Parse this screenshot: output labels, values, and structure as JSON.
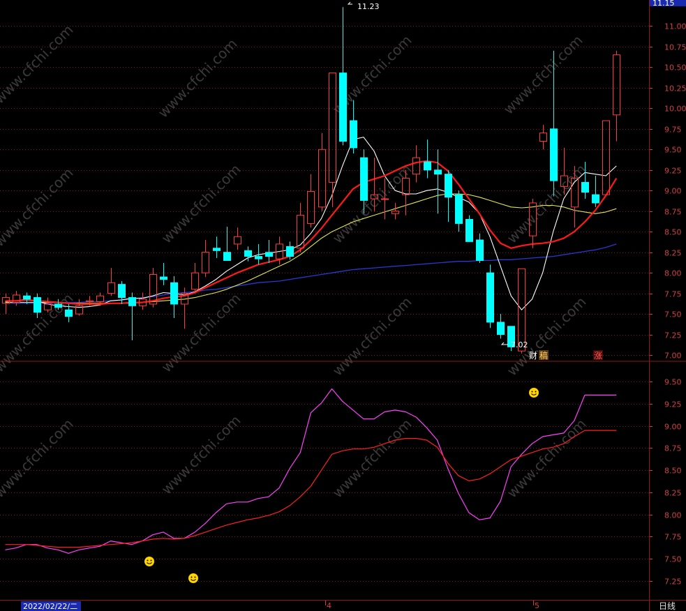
{
  "colors": {
    "background": "#000000",
    "frame": "#8b1a1a",
    "grid": "#7a1a1a",
    "tick_text": "#d04040",
    "up_candle": "#ff3c3c",
    "down_candle": "#00ffff",
    "ma_fast": "#ffffff",
    "ma_mid": "#ff1a1a",
    "ma_slow": "#e8e84a",
    "ma_long": "#2838d0",
    "osc_fast": "#ff40ff",
    "osc_slow": "#ff2020"
  },
  "header": {
    "price_box": "11.15"
  },
  "footer": {
    "date_box": "2022/02/22/二",
    "period_label": "日线",
    "month_4": "4",
    "month_5": "5"
  },
  "watermark": "www.cfchi.com",
  "markers": {
    "high_label": "11.23",
    "low_label": "7.02",
    "tag_cai": "财",
    "tag_gao": "稿",
    "tag_zhang": "涨"
  },
  "chart_data": [
    {
      "type": "candlestick",
      "title": "",
      "ylim": [
        6.95,
        11.3
      ],
      "y_ticks": [
        "11.00",
        "10.75",
        "10.50",
        "10.25",
        "10.00",
        "9.75",
        "9.50",
        "9.25",
        "9.00",
        "8.75",
        "8.50",
        "8.25",
        "8.00",
        "7.75",
        "7.50",
        "7.25",
        "7.00"
      ],
      "candles": [
        [
          7.63,
          7.7,
          7.75,
          7.5
        ],
        [
          7.64,
          7.73,
          7.78,
          7.6
        ],
        [
          7.72,
          7.68,
          7.76,
          7.62
        ],
        [
          7.7,
          7.52,
          7.75,
          7.45
        ],
        [
          7.55,
          7.62,
          7.7,
          7.52
        ],
        [
          7.62,
          7.58,
          7.68,
          7.55
        ],
        [
          7.55,
          7.47,
          7.62,
          7.4
        ],
        [
          7.5,
          7.6,
          7.68,
          7.48
        ],
        [
          7.65,
          7.66,
          7.72,
          7.6
        ],
        [
          7.65,
          7.72,
          7.76,
          7.6
        ],
        [
          7.75,
          7.88,
          8.06,
          7.72
        ],
        [
          7.86,
          7.7,
          7.9,
          7.62
        ],
        [
          7.7,
          7.6,
          7.76,
          7.18
        ],
        [
          7.6,
          7.68,
          7.76,
          7.55
        ],
        [
          7.62,
          7.98,
          8.06,
          7.58
        ],
        [
          7.95,
          7.92,
          8.12,
          7.85
        ],
        [
          7.88,
          7.62,
          7.96,
          7.45
        ],
        [
          7.62,
          7.75,
          7.82,
          7.32
        ],
        [
          7.8,
          8.0,
          8.12,
          7.75
        ],
        [
          8.0,
          8.25,
          8.4,
          7.95
        ],
        [
          8.3,
          8.27,
          8.44,
          8.18
        ],
        [
          8.25,
          8.15,
          8.56,
          8.2
        ],
        [
          8.35,
          8.44,
          8.55,
          8.28
        ],
        [
          8.27,
          8.2,
          8.32,
          8.14
        ],
        [
          8.2,
          8.17,
          8.35,
          8.1
        ],
        [
          8.25,
          8.2,
          8.4,
          8.12
        ],
        [
          8.17,
          8.35,
          8.44,
          8.1
        ],
        [
          8.32,
          8.2,
          8.38,
          8.16
        ],
        [
          8.3,
          8.7,
          8.85,
          8.25
        ],
        [
          8.6,
          8.99,
          9.2,
          8.55
        ],
        [
          8.8,
          9.5,
          9.7,
          8.75
        ],
        [
          9.1,
          10.43,
          10.43,
          8.8
        ],
        [
          10.43,
          9.6,
          11.23,
          9.55
        ],
        [
          9.85,
          9.52,
          10.1,
          9.45
        ],
        [
          9.4,
          8.88,
          9.5,
          8.72
        ],
        [
          8.9,
          8.95,
          9.4,
          8.75
        ],
        [
          8.9,
          8.9,
          9.15,
          8.65
        ],
        [
          8.72,
          8.75,
          8.85,
          8.65
        ],
        [
          8.95,
          9.15,
          9.25,
          8.7
        ],
        [
          9.2,
          9.4,
          9.55,
          9.1
        ],
        [
          9.35,
          9.25,
          9.62,
          9.15
        ],
        [
          9.25,
          9.2,
          9.5,
          8.72
        ],
        [
          9.2,
          8.92,
          9.25,
          8.62
        ],
        [
          8.95,
          8.6,
          9.0,
          8.5
        ],
        [
          8.65,
          8.38,
          8.7,
          8.38
        ],
        [
          8.4,
          8.15,
          8.48,
          8.12
        ],
        [
          8.0,
          7.4,
          8.1,
          7.33
        ],
        [
          7.4,
          7.25,
          7.5,
          7.2
        ],
        [
          7.35,
          7.1,
          7.25,
          7.05
        ],
        [
          7.05,
          8.05,
          8.05,
          7.02
        ],
        [
          8.45,
          8.85,
          8.9,
          8.3
        ],
        [
          9.6,
          9.7,
          9.8,
          9.5
        ],
        [
          9.75,
          9.12,
          10.7,
          8.93
        ],
        [
          9.05,
          9.18,
          9.52,
          8.95
        ],
        [
          8.8,
          9.15,
          9.3,
          8.55
        ],
        [
          9.1,
          8.98,
          9.35,
          8.9
        ],
        [
          8.95,
          8.85,
          9.18,
          8.8
        ],
        [
          8.95,
          9.85,
          9.85,
          8.95
        ],
        [
          9.92,
          10.65,
          10.7,
          9.6
        ]
      ],
      "ma_fast": [
        7.65,
        7.66,
        7.68,
        7.66,
        7.62,
        7.6,
        7.59,
        7.58,
        7.59,
        7.61,
        7.66,
        7.67,
        7.69,
        7.69,
        7.72,
        7.76,
        7.75,
        7.73,
        7.77,
        7.84,
        7.92,
        8.02,
        8.1,
        8.18,
        8.22,
        8.24,
        8.26,
        8.28,
        8.34,
        8.48,
        8.66,
        8.94,
        9.3,
        9.62,
        9.65,
        9.48,
        9.18,
        9.0,
        8.96,
        8.96,
        9.0,
        9.02,
        8.98,
        8.92,
        8.86,
        8.72,
        8.44,
        8.08,
        7.72,
        7.55,
        7.68,
        8.0,
        8.5,
        8.9,
        9.1,
        9.22,
        9.2,
        9.18,
        9.3
      ],
      "ma_mid": [
        7.66,
        7.66,
        7.67,
        7.66,
        7.65,
        7.64,
        7.63,
        7.62,
        7.62,
        7.62,
        7.63,
        7.63,
        7.64,
        7.64,
        7.66,
        7.69,
        7.71,
        7.72,
        7.76,
        7.82,
        7.88,
        7.94,
        8.0,
        8.05,
        8.1,
        8.13,
        8.16,
        8.2,
        8.28,
        8.4,
        8.54,
        8.7,
        8.86,
        9.02,
        9.1,
        9.14,
        9.18,
        9.24,
        9.3,
        9.34,
        9.36,
        9.34,
        9.24,
        9.08,
        8.9,
        8.72,
        8.52,
        8.36,
        8.3,
        8.33,
        8.35,
        8.36,
        8.38,
        8.42,
        8.5,
        8.62,
        8.76,
        8.94,
        9.15
      ],
      "ma_slow": [
        7.64,
        7.64,
        7.64,
        7.64,
        7.64,
        7.64,
        7.63,
        7.63,
        7.63,
        7.63,
        7.63,
        7.63,
        7.63,
        7.64,
        7.65,
        7.66,
        7.67,
        7.68,
        7.7,
        7.73,
        7.76,
        7.8,
        7.85,
        7.9,
        7.96,
        8.02,
        8.08,
        8.14,
        8.22,
        8.32,
        8.42,
        8.5,
        8.56,
        8.62,
        8.66,
        8.7,
        8.74,
        8.78,
        8.82,
        8.86,
        8.9,
        8.94,
        8.96,
        8.96,
        8.95,
        8.92,
        8.88,
        8.84,
        8.8,
        8.79,
        8.8,
        8.82,
        8.82,
        8.8,
        8.76,
        8.74,
        8.72,
        8.74,
        8.78
      ],
      "ma_long": [
        7.63,
        7.63,
        7.63,
        7.63,
        7.63,
        7.64,
        7.64,
        7.64,
        7.65,
        7.65,
        7.66,
        7.67,
        7.68,
        7.7,
        7.71,
        7.73,
        7.75,
        7.76,
        7.77,
        7.79,
        7.8,
        7.82,
        7.84,
        7.86,
        7.88,
        7.89,
        7.9,
        7.92,
        7.94,
        7.96,
        7.98,
        8.0,
        8.02,
        8.04,
        8.05,
        8.06,
        8.07,
        8.08,
        8.09,
        8.1,
        8.11,
        8.12,
        8.13,
        8.14,
        8.14,
        8.15,
        8.15,
        8.16,
        8.16,
        8.17,
        8.18,
        8.19,
        8.2,
        8.22,
        8.24,
        8.26,
        8.28,
        8.31,
        8.35
      ]
    },
    {
      "type": "line",
      "title": "",
      "ylim": [
        7.05,
        9.7
      ],
      "y_ticks": [
        "9.50",
        "9.25",
        "9.00",
        "8.75",
        "8.50",
        "8.25",
        "8.00",
        "7.75",
        "7.50",
        "7.25"
      ],
      "series": [
        {
          "values": [
            7.6,
            7.62,
            7.66,
            7.66,
            7.62,
            7.6,
            7.56,
            7.6,
            7.62,
            7.64,
            7.7,
            7.68,
            7.66,
            7.7,
            7.77,
            7.8,
            7.73,
            7.73,
            7.8,
            7.9,
            8.02,
            8.12,
            8.14,
            8.14,
            8.18,
            8.2,
            8.3,
            8.52,
            8.7,
            9.15,
            9.26,
            9.42,
            9.28,
            9.18,
            9.08,
            9.08,
            9.16,
            9.18,
            9.16,
            9.1,
            8.98,
            8.84,
            8.52,
            8.24,
            8.02,
            7.94,
            7.96,
            8.15,
            8.54,
            8.68,
            8.8,
            8.88,
            8.9,
            8.92,
            9.06,
            9.35,
            9.35,
            9.35,
            9.35
          ]
        },
        {
          "values": [
            7.66,
            7.66,
            7.66,
            7.65,
            7.64,
            7.63,
            7.63,
            7.63,
            7.64,
            7.65,
            7.66,
            7.67,
            7.68,
            7.7,
            7.72,
            7.73,
            7.72,
            7.73,
            7.76,
            7.8,
            7.84,
            7.88,
            7.91,
            7.94,
            7.96,
            7.99,
            8.03,
            8.1,
            8.2,
            8.32,
            8.5,
            8.68,
            8.72,
            8.74,
            8.74,
            8.76,
            8.8,
            8.84,
            8.86,
            8.86,
            8.84,
            8.76,
            8.58,
            8.44,
            8.38,
            8.4,
            8.46,
            8.54,
            8.62,
            8.66,
            8.7,
            8.74,
            8.76,
            8.8,
            8.88,
            8.95,
            8.95,
            8.95,
            8.95
          ]
        }
      ]
    }
  ]
}
